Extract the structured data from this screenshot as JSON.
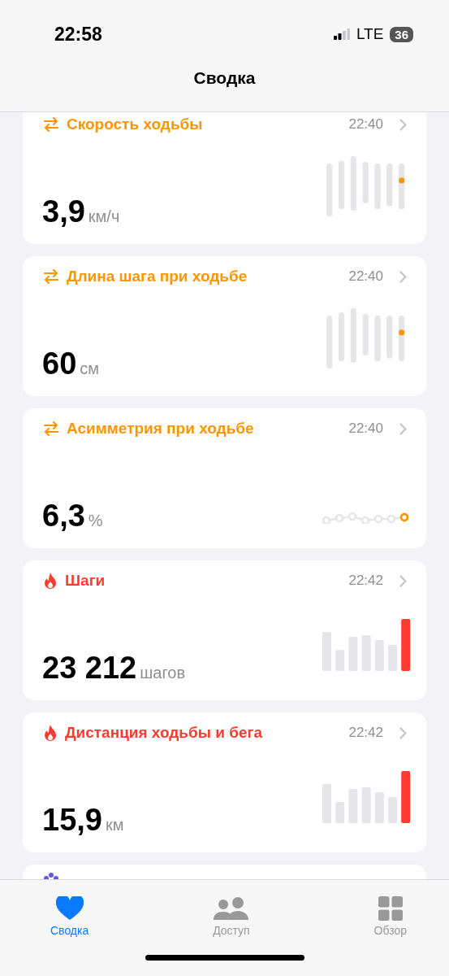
{
  "status_bar": {
    "time": "22:58",
    "network": "LTE",
    "battery": "36"
  },
  "title": "Сводка",
  "cards": [
    {
      "title": "Скорость ходьбы",
      "color": "#ff9500",
      "time": "22:40",
      "value": "3,9",
      "unit": "км/ч",
      "kind": "range"
    },
    {
      "title": "Длина шага при ходьбе",
      "color": "#ff9500",
      "time": "22:40",
      "value": "60",
      "unit": "см",
      "kind": "range"
    },
    {
      "title": "Асимметрия при ходьбе",
      "color": "#ff9500",
      "time": "22:40",
      "value": "6,3",
      "unit": "%",
      "kind": "dots"
    },
    {
      "title": "Шаги",
      "color": "#ff3b30",
      "time": "22:42",
      "value": "23 212",
      "unit": "шагов",
      "kind": "bars"
    },
    {
      "title": "Дистанция ходьбы и бега",
      "color": "#ff3b30",
      "time": "22:42",
      "value": "15,9",
      "unit": "км",
      "kind": "bars"
    }
  ],
  "peek_card": {
    "color": "#5e5ce6"
  },
  "tabs": [
    {
      "label": "Сводка",
      "selected": true
    },
    {
      "label": "Доступ",
      "selected": false
    },
    {
      "label": "Обзор",
      "selected": false
    }
  ]
}
